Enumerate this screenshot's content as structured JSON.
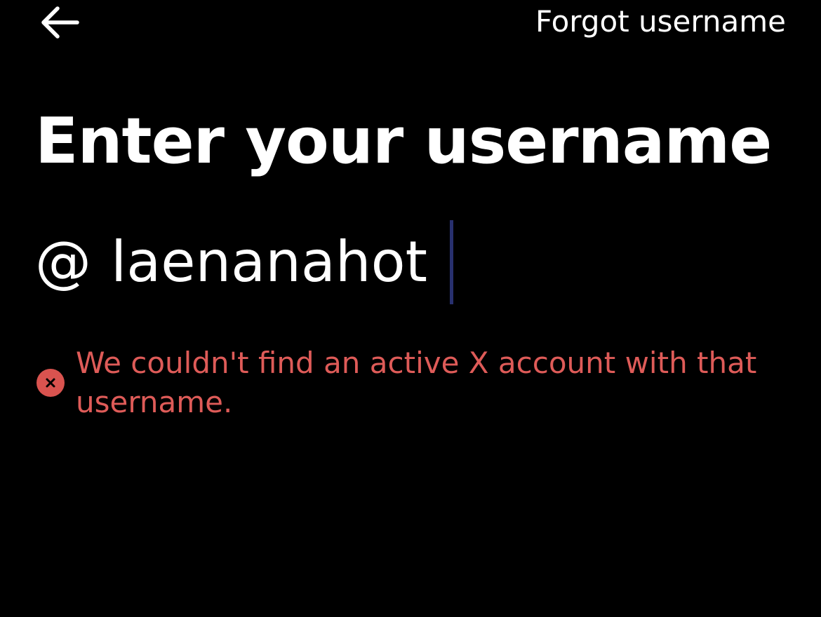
{
  "header": {
    "back_icon": "arrow-left-icon",
    "forgot_label": "Forgot username"
  },
  "main": {
    "title": "Enter your username",
    "username_prefix": "@",
    "username_value": "laenanahot"
  },
  "error": {
    "icon": "close-circle-icon",
    "message": "We couldn't find an active X account with that username."
  },
  "colors": {
    "background": "#000000",
    "text": "#ffffff",
    "error": "#de5b58",
    "caret": "#28306e"
  }
}
